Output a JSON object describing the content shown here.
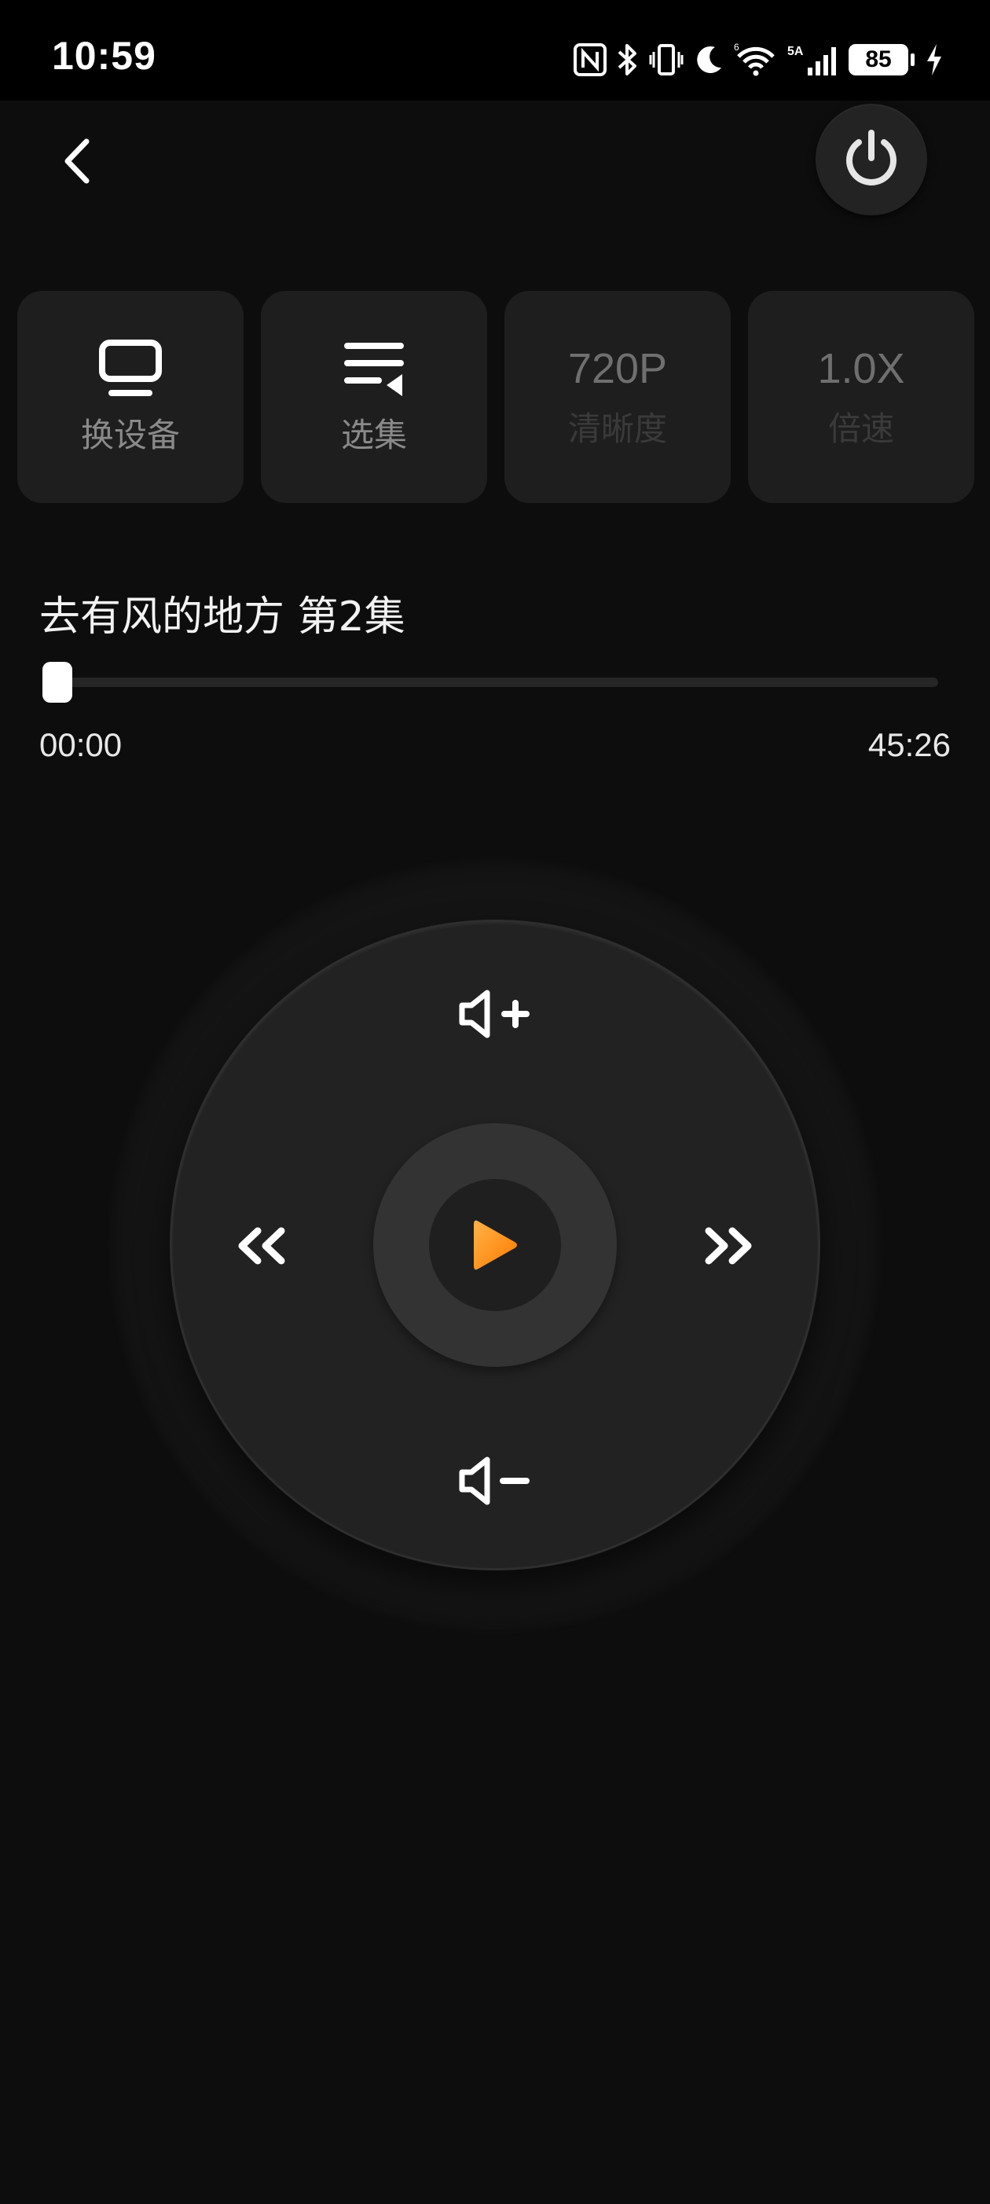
{
  "status_bar": {
    "time": "10:59",
    "battery": "85",
    "icons": [
      "nfc-icon",
      "bluetooth-icon",
      "vibrate-icon",
      "moon-icon",
      "wifi-icon",
      "signal-5a-icon",
      "battery-icon",
      "charging-icon"
    ]
  },
  "header": {
    "back_icon": "chevron-left-icon",
    "power_icon": "power-icon"
  },
  "tiles": [
    {
      "icon": "monitor-icon",
      "label": "换设备",
      "enabled": true
    },
    {
      "icon": "playlist-icon",
      "label": "选集",
      "enabled": true
    },
    {
      "value": "720P",
      "label": "清晰度",
      "enabled": false
    },
    {
      "value": "1.0X",
      "label": "倍速",
      "enabled": false
    }
  ],
  "player": {
    "title": "去有风的地方 第2集",
    "current_time": "00:00",
    "total_time": "45:26",
    "progress": 0.0
  },
  "remote": {
    "volume_up_icon": "volume-up-icon",
    "volume_down_icon": "volume-down-icon",
    "rewind_icon": "rewind-icon",
    "fast_forward_icon": "fast-forward-icon",
    "play_icon": "play-icon",
    "accent": "#ff9a1f"
  }
}
